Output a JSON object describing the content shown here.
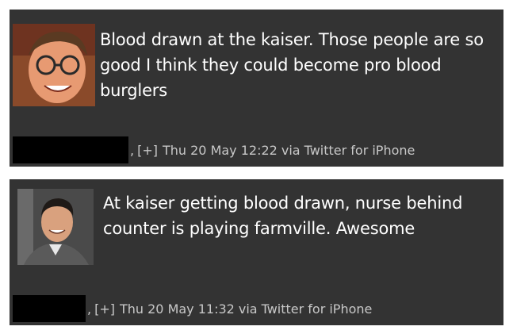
{
  "tweets": [
    {
      "avatar_icon": "user-avatar-man-glasses",
      "text": "Blood drawn at the kaiser. Those people are so good I think they could become pro blood burglers",
      "separator": ",",
      "expand_label": "[+]",
      "timestamp": "Thu 20 May 12:22",
      "via_label": "via",
      "source": "Twitter for iPhone"
    },
    {
      "avatar_icon": "user-avatar-man-smiling",
      "text": "At kaiser getting blood drawn, nurse behind counter is playing farmville. Awesome",
      "separator": ",",
      "expand_label": "[+]",
      "timestamp": "Thu 20 May 11:32",
      "via_label": "via",
      "source": "Twitter for iPhone"
    }
  ],
  "colors": {
    "card_background": "#333333",
    "text": "#ffffff",
    "meta_text": "#c8c8c8",
    "redaction": "#000000"
  }
}
